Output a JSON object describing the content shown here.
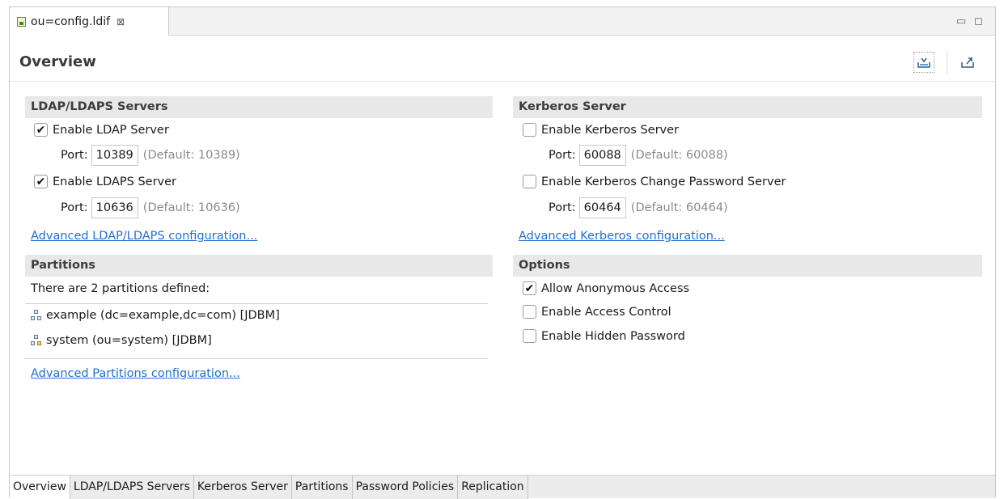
{
  "editor_tab": {
    "label": "ou=config.ldif",
    "close": "⊠"
  },
  "window_controls": {
    "minimize": "▭",
    "maximize": "◻"
  },
  "header": {
    "title": "Overview"
  },
  "ldap": {
    "heading": "LDAP/LDAPS Servers",
    "enable_ldap": {
      "label": "Enable LDAP Server",
      "checked": true
    },
    "ldap_port": {
      "label": "Port:",
      "value": "10389",
      "default": "(Default: 10389)"
    },
    "enable_ldaps": {
      "label": "Enable LDAPS Server",
      "checked": true
    },
    "ldaps_port": {
      "label": "Port:",
      "value": "10636",
      "default": "(Default: 10636)"
    },
    "advanced_link": "Advanced LDAP/LDAPS configuration..."
  },
  "kerberos": {
    "heading": "Kerberos Server",
    "enable_kerberos": {
      "label": "Enable Kerberos Server",
      "checked": false
    },
    "kerberos_port": {
      "label": "Port:",
      "value": "60088",
      "default": "(Default: 60088)"
    },
    "enable_change_pw": {
      "label": "Enable Kerberos Change Password Server",
      "checked": false
    },
    "change_pw_port": {
      "label": "Port:",
      "value": "60464",
      "default": "(Default: 60464)"
    },
    "advanced_link": "Advanced Kerberos configuration..."
  },
  "partitions": {
    "heading": "Partitions",
    "summary": "There are 2 partitions defined:",
    "items": [
      {
        "label": "example (dc=example,dc=com) [JDBM]"
      },
      {
        "label": "system (ou=system) [JDBM]"
      }
    ],
    "advanced_link": "Advanced Partitions configuration..."
  },
  "options": {
    "heading": "Options",
    "allow_anonymous": {
      "label": "Allow Anonymous Access",
      "checked": true
    },
    "access_control": {
      "label": "Enable Access Control",
      "checked": false
    },
    "hidden_password": {
      "label": "Enable Hidden Password",
      "checked": false
    }
  },
  "bottom_tabs": [
    {
      "label": "Overview",
      "active": true
    },
    {
      "label": "LDAP/LDAPS Servers",
      "active": false
    },
    {
      "label": "Kerberos Server",
      "active": false
    },
    {
      "label": "Partitions",
      "active": false
    },
    {
      "label": "Password Policies",
      "active": false
    },
    {
      "label": "Replication",
      "active": false
    }
  ]
}
